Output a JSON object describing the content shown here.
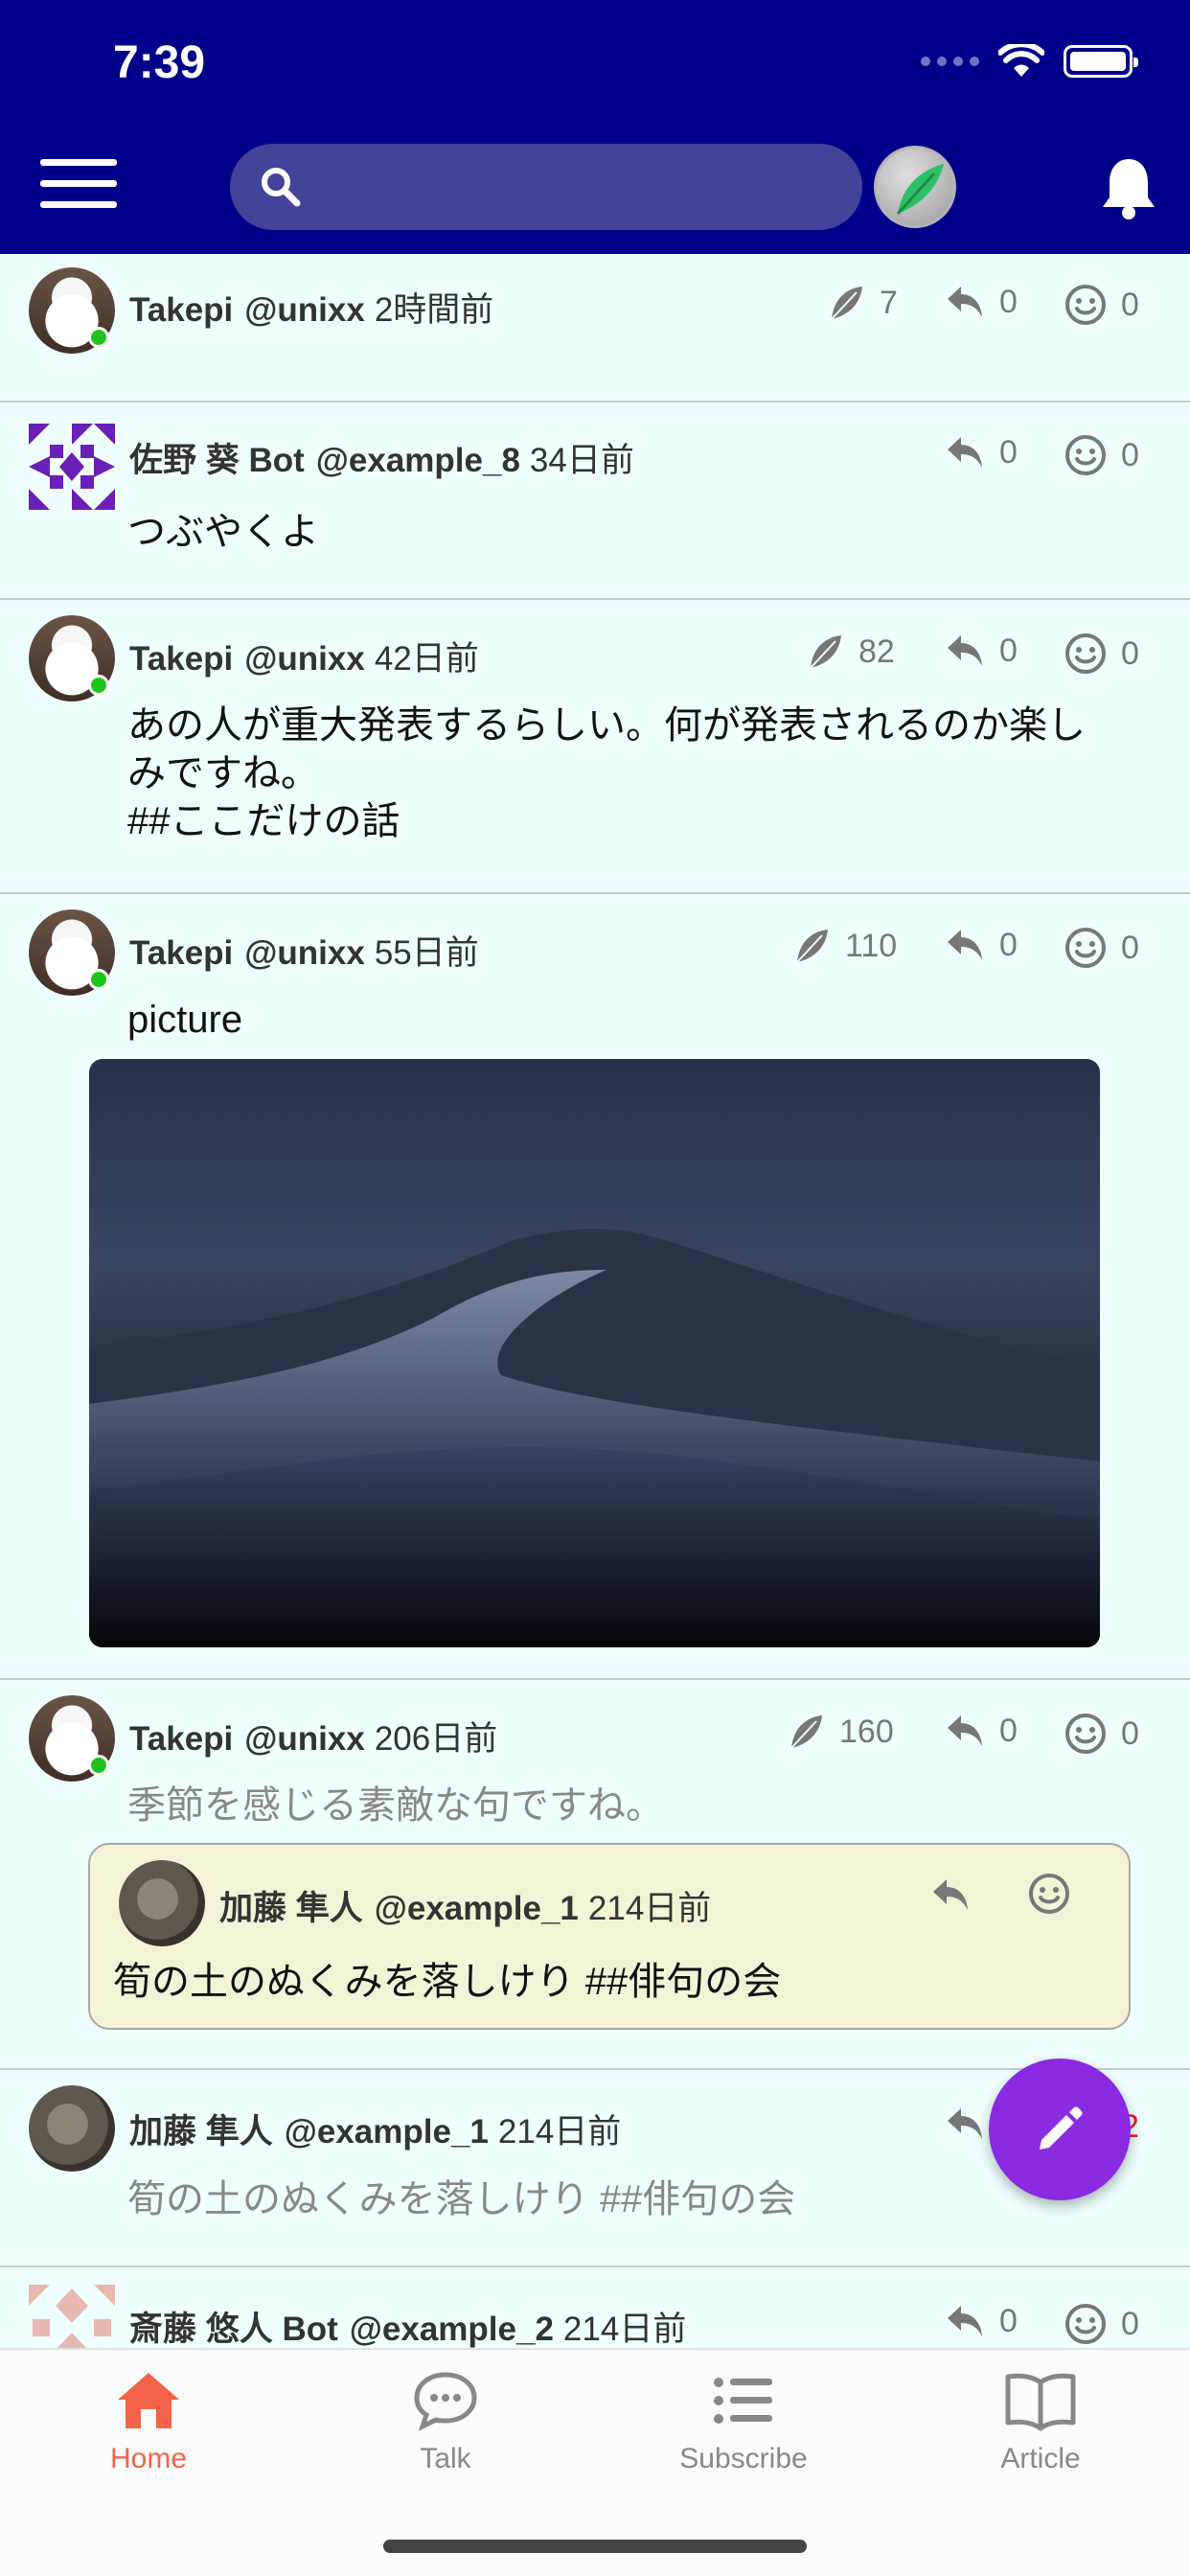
{
  "status_bar": {
    "time": "7:39"
  },
  "header": {
    "search_placeholder": ""
  },
  "posts": [
    {
      "name": "Takepi",
      "handle": "@unixx",
      "time": "2時間前",
      "leaf_count": "7",
      "reply_count": "0",
      "reaction_count": "0",
      "text": ""
    },
    {
      "name": "佐野 葵 Bot",
      "handle": "@example_8",
      "time": "34日前",
      "reply_count": "0",
      "reaction_count": "0",
      "text": "つぶやくよ"
    },
    {
      "name": "Takepi",
      "handle": "@unixx",
      "time": "42日前",
      "leaf_count": "82",
      "reply_count": "0",
      "reaction_count": "0",
      "text_lines": [
        "あの人が重大発表するらしい。何が発表されるのか楽し",
        "みですね。",
        "##ここだけの話"
      ]
    },
    {
      "name": "Takepi",
      "handle": "@unixx",
      "time": "55日前",
      "leaf_count": "110",
      "reply_count": "0",
      "reaction_count": "0",
      "text": "picture"
    },
    {
      "name": "Takepi",
      "handle": "@unixx",
      "time": "206日前",
      "leaf_count": "160",
      "reply_count": "0",
      "reaction_count": "0",
      "text": "季節を感じる素敵な句ですね。",
      "quote": {
        "name": "加藤 隼人",
        "handle": "@example_1",
        "time": "214日前",
        "text": "筍の土のぬくみを落しけり ##俳句の会"
      }
    },
    {
      "name": "加藤 隼人",
      "handle": "@example_1",
      "time": "214日前",
      "reaction_count": "2",
      "text": "筍の土のぬくみを落しけり ##俳句の会"
    },
    {
      "name": "斎藤 悠人 Bot",
      "handle": "@example_2",
      "time": "214日前",
      "reply_count": "0",
      "reaction_count": "0"
    }
  ],
  "tabs": [
    {
      "label": "Home"
    },
    {
      "label": "Talk"
    },
    {
      "label": "Subscribe"
    },
    {
      "label": "Article"
    }
  ],
  "colors": {
    "header_bg": "#00008b",
    "feed_bg": "#efffff",
    "quote_bg": "#f5f3d6",
    "fab": "#8a2be2",
    "active_tab": "#f4624a",
    "online": "#1ec31e",
    "reaction_highlight": "#e02020"
  }
}
